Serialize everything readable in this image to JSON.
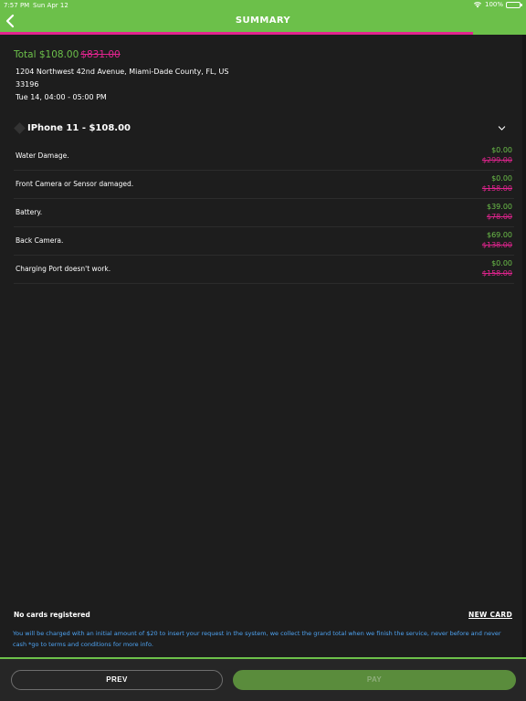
{
  "status_bar": {
    "time": "7:57 PM",
    "date": "Sun Apr 12",
    "battery": "100%"
  },
  "header": {
    "title": "SUMMARY",
    "progress_fraction": 0.9
  },
  "summary": {
    "total_label": "Total",
    "total_now": "$108.00",
    "total_old": "$831.00",
    "address_line1": "1204 Northwest 42nd Avenue,  Miami-Dade County, FL, US",
    "address_line2": "33196",
    "appointment": "Tue 14, 04:00 - 05:00 PM"
  },
  "device": {
    "name": "IPhone 11 - $108.00"
  },
  "items": [
    {
      "label": "Water Damage.",
      "price_now": "$0.00",
      "price_old": "$299.00"
    },
    {
      "label": "Front Camera or Sensor damaged.",
      "price_now": "$0.00",
      "price_old": "$158.00"
    },
    {
      "label": "Battery.",
      "price_now": "$39.00",
      "price_old": "$78.00"
    },
    {
      "label": "Back Camera.",
      "price_now": "$69.00",
      "price_old": "$138.00"
    },
    {
      "label": "Charging Port doesn't work.",
      "price_now": "$0.00",
      "price_old": "$158.00"
    }
  ],
  "payment": {
    "no_cards": "No cards registered",
    "new_card": "NEW CARD",
    "notice": "You will be charged with an initial amount of $20 to insert your request in the system, we collect the grand total when we finish the service, never before and never cash *go to terms and conditions for more info."
  },
  "footer": {
    "prev_label": "PREV",
    "pay_label": "PAY"
  },
  "colors": {
    "accent": "#6cc04a",
    "strike": "#e2248f",
    "notice": "#4ea3f2",
    "background": "#1d1d1d"
  }
}
